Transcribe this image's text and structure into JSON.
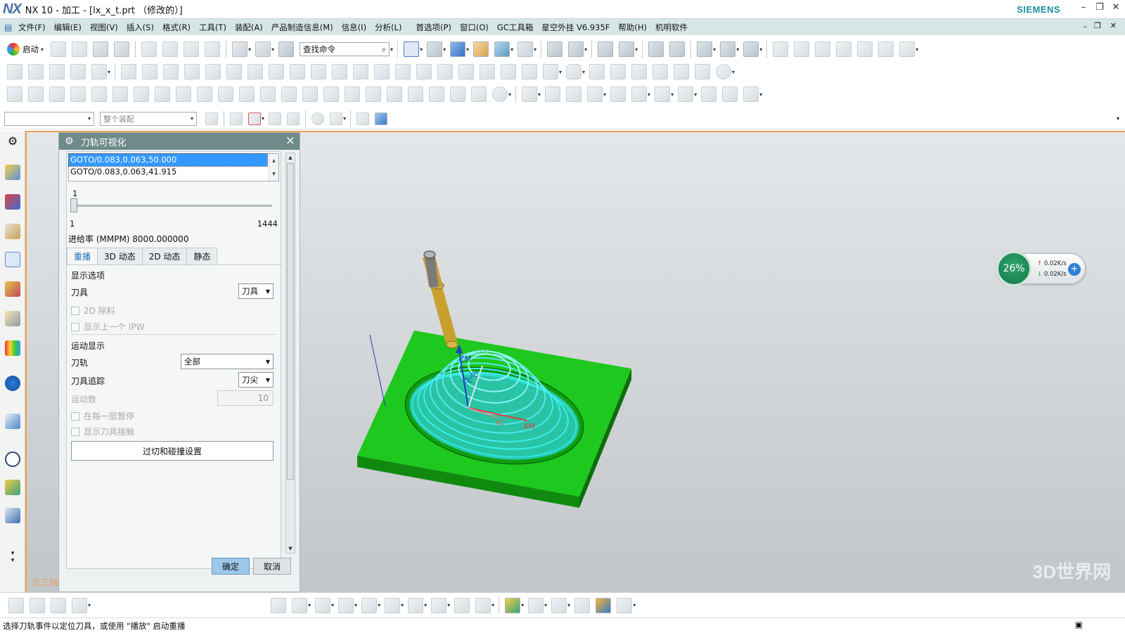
{
  "window": {
    "logo": "NX",
    "title": "NX 10 - 加工 - [lx_x_t.prt （修改的）]",
    "brand": "SIEMENS",
    "minimize": "–",
    "restore": "❐",
    "close": "✕"
  },
  "menu": [
    "文件(F)",
    "编辑(E)",
    "视图(V)",
    "插入(S)",
    "格式(R)",
    "工具(T)",
    "装配(A)",
    "产品制造信息(M)",
    "信息(I)",
    "分析(L)",
    "首选项(P)",
    "窗口(O)",
    "GC工具箱",
    "星空外挂 V6.935F",
    "帮助(H)",
    "机明软件"
  ],
  "toolbar": {
    "start_label": "启动",
    "find_command": "查找命令",
    "selection_filter": "",
    "assembly_scope": "整个装配"
  },
  "dialog": {
    "title": "刀轨可视化",
    "goto_items": [
      "GOTO/0.083,0.063,50.000",
      "GOTO/0.083,0.063,41.915"
    ],
    "slider_current": "1",
    "slider_min": "1",
    "slider_max": "1444",
    "slider_fraction": 0,
    "feed_rate": "进给率 (MMPM) 8000.000000",
    "tabs": [
      "重播",
      "3D 动态",
      "2D 动态",
      "静态"
    ],
    "active_tab": "重播",
    "display_options": "显示选项",
    "tool_label": "刀具",
    "tool_value": "刀具",
    "chk_2d_removal": "2D 除料",
    "chk_prev_ipw": "显示上一个 IPW",
    "motion_display": "运动显示",
    "toolpath_label": "刀轨",
    "toolpath_value": "全部",
    "tool_trace_label": "刀具追踪",
    "tool_trace_value": "刀尖",
    "motion_count_label": "运动数",
    "motion_count_value": "10",
    "chk_pause_layer": "在每一层暂停",
    "chk_tool_contact": "显示刀具接触",
    "gouge_button": "过切和碰撞设置",
    "ok": "确定",
    "cancel": "取消"
  },
  "viewport": {
    "view_label": "正三轴",
    "watermark": "3D世界网",
    "axis_labels": {
      "zm": "ZM",
      "yc": "YC",
      "zc": "ZC",
      "xc": "XC",
      "xm": "XM",
      "ym": "YM"
    },
    "colors": {
      "stock": "#1ec81e",
      "toolpath": "#30e8e0",
      "tool_holder": "#c8a030",
      "tool_shank": "#808080"
    }
  },
  "net_speed": {
    "percent": "26%",
    "up": "0.02K/s",
    "down": "0.02K/s"
  },
  "status": "选择刀轨事件以定位刀具，或使用 \"播放\" 启动重播"
}
